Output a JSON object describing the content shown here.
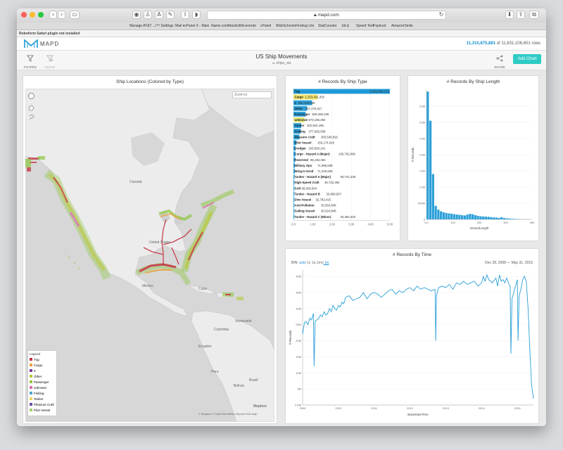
{
  "browser": {
    "url": "mapd.com",
    "bookmarks": [
      "Manage AT&T ...l™ Settings",
      "Mail ▾",
      "cPanel X - Main",
      "Name.com",
      "MarsEdit",
      "Evernote",
      "cPanel",
      "WebSchools",
      "Firebug Lite",
      "StatCounter",
      "bit.ly",
      "Speed Test",
      "Paytrust",
      "AmazonSmile"
    ],
    "plugin_notice": "Roboform Safari plugin not installed"
  },
  "app": {
    "logo_text": "MAPD",
    "rows_filtered": "11,310,875,881",
    "rows_total_text": "of 11,631,106,601 rows",
    "dashboard_title": "US Ship Movements",
    "table_name": "ships_ais",
    "filters_label": "FILTERS",
    "clear_label": "CLEAR",
    "share_label": "SHARE",
    "add_chart_label": "Add Chart",
    "accent": "#29b6f6",
    "add_chart_color": "#2ecbc4"
  },
  "map_panel": {
    "title": "Ship Locations (Colored by Type)",
    "zoom_placeholder": "Zoom to",
    "labels": [
      "Canada",
      "United States",
      "Mexico",
      "Cuba",
      "Venezuela",
      "Colombia",
      "Ecuador",
      "Peru",
      "Brazil",
      "Bolivia"
    ],
    "legend_title": "Legend",
    "legend": [
      {
        "label": "Tug",
        "color": "#c2313d"
      },
      {
        "label": "Cargo",
        "color": "#e8a23a"
      },
      {
        "label": "0",
        "color": "#7b3b9b"
      },
      {
        "label": "Other",
        "color": "#b6c93a"
      },
      {
        "label": "Passenger",
        "color": "#8dc63f"
      },
      {
        "label": "unknown",
        "color": "#d86fae"
      },
      {
        "label": "Fishing",
        "color": "#4fa3d1"
      },
      {
        "label": "Tanker",
        "color": "#e9d85a"
      },
      {
        "label": "Pleasure Craft",
        "color": "#6a50a7"
      },
      {
        "label": "Pilot Vessel",
        "color": "#a0d36e"
      }
    ],
    "attribution": "© Mapbox © OpenStreetMap Improve this map",
    "mapbox_logo": "Mapbox"
  },
  "chart_data": [
    {
      "type": "bar",
      "orientation": "horizontal",
      "title": "# Records By Ship Type",
      "categories": [
        "Tug",
        "Cargo",
        "0",
        "Other",
        "Passenger",
        "unknown",
        "Tanker",
        "Fishing",
        "Pleasure Craft",
        "Pilot Vessel",
        "Dredger",
        "Cargo - Hazard A (Major)",
        "Reserved",
        "Military Ops",
        "Wing In Grnd",
        "Tanker - Hazard A (Major)",
        "High-Speed Craft",
        "SAR",
        "Tanker - Hazard B",
        "Dive Vessel",
        "Anti-Pollution",
        "Sailing Vessel",
        "Tanker - Hazard C (Minor)"
      ],
      "value_labels": [
        "5,362,686,215",
        "1,253,441,355",
        "965,436,589",
        "707,175,317",
        "628,450,346",
        "573,186,292",
        "402,910,196",
        "377,665,508",
        "305,548,826",
        "155,174,918",
        "103,560,241",
        "100,762,096",
        "95,192,452",
        "71,895,538",
        "71,319,536",
        "50,741,239",
        "46,722,394",
        "38,928,034",
        "33,808,507",
        "32,782,415",
        "30,553,848",
        "30,024,848",
        "20,364,402"
      ],
      "values": [
        5362686215,
        1253441355,
        965436589,
        707175317,
        628450346,
        573186292,
        402910196,
        377665508,
        305548826,
        155174918,
        103560241,
        100762096,
        95192452,
        71895538,
        71319536,
        50741239,
        46722394,
        38928034,
        33808507,
        32782415,
        30553848,
        30024848,
        20364402
      ],
      "colors": [
        "#1f9ad6",
        "#f0e36a",
        "#2a9fd8",
        "#2a9fd8",
        "#2a9fd8",
        "#e8e87a",
        "#2a9fd8",
        "#2a9fd8",
        "#2a9fd8",
        "#2a9fd8",
        "#2a9fd8",
        "#2a9fd8",
        "#2a9fd8",
        "#2a9fd8",
        "#2a9fd8",
        "#2a9fd8",
        "#2a9fd8",
        "#2a9fd8",
        "#2a9fd8",
        "#2a9fd8",
        "#2a9fd8",
        "#2a9fd8",
        "#2a9fd8"
      ],
      "xlim": [
        0,
        5000000000
      ],
      "x_ticks": [
        "0.0",
        "1.00",
        "2.00",
        "3.00",
        "4.00",
        "5.00"
      ],
      "grid": true
    },
    {
      "type": "bar",
      "title": "# Records By Ship Length",
      "xlabel": "VesselLength",
      "ylabel": "# Records",
      "x": [
        5,
        15,
        25,
        35,
        45,
        55,
        65,
        75,
        85,
        95,
        105,
        115,
        125,
        135,
        145,
        155,
        165,
        175,
        185,
        195,
        205,
        215,
        225,
        235,
        245,
        255,
        265,
        275,
        285,
        295,
        305,
        315,
        325,
        335,
        345,
        355,
        365,
        375,
        385,
        395
      ],
      "values": [
        3950000000,
        3050000000,
        1400000000,
        420000000,
        300000000,
        250000000,
        220000000,
        200000000,
        185000000,
        175000000,
        160000000,
        150000000,
        140000000,
        130000000,
        120000000,
        150000000,
        170000000,
        160000000,
        130000000,
        110000000,
        95000000,
        90000000,
        85000000,
        80000000,
        70000000,
        60000000,
        55000000,
        45000000,
        70000000,
        40000000,
        30000000,
        25000000,
        18000000,
        12000000,
        8000000,
        5000000,
        3000000,
        2000000,
        1000000,
        500000
      ],
      "xlim": [
        0,
        400
      ],
      "x_ticks": [
        "0.0",
        "100",
        "200",
        "300",
        "400"
      ],
      "ylim": [
        0,
        4000000000
      ],
      "y_ticks": [
        "0",
        "500M",
        "1.0B",
        "1.5B",
        "2.0B",
        "2.5B",
        "3.0B",
        "3.5B"
      ],
      "grid": true,
      "color": "#2a9fd8"
    },
    {
      "type": "line",
      "title": "# Records By Time",
      "xlabel": "BaseDateTime",
      "ylabel": "# Records",
      "bin_label": "BIN:",
      "bin_options": [
        "auto",
        "1y",
        "1q",
        "1mo",
        "1w"
      ],
      "bin_selected": "1w",
      "date_range": "Dec 28, 2008 — May 31, 2015",
      "x_ticks": [
        "2009",
        "2010",
        "2011",
        "2012",
        "2013",
        "2014",
        "2015"
      ],
      "y_ticks": [
        "0.0M",
        "5M",
        "10M",
        "15M",
        "20M",
        "25M",
        "30M",
        "35M",
        "40M"
      ],
      "ylim": [
        0,
        42000000
      ],
      "xlim": [
        2009.0,
        2015.45
      ],
      "color": "#2a9fd8",
      "series": [
        {
          "x": [
            2009.0,
            2009.05,
            2009.1,
            2009.15,
            2009.2,
            2009.25,
            2009.3,
            2009.32,
            2009.35,
            2009.4,
            2009.45,
            2009.5,
            2009.55,
            2009.6,
            2009.65,
            2009.7,
            2009.75,
            2009.8,
            2009.85,
            2009.9,
            2009.95,
            2010.0,
            2010.05,
            2010.1,
            2010.15,
            2010.2,
            2010.3,
            2010.4,
            2010.5,
            2010.6,
            2010.7,
            2010.8,
            2010.9,
            2011.0,
            2011.1,
            2011.2,
            2011.3,
            2011.4,
            2011.5,
            2011.6,
            2011.7,
            2011.8,
            2011.9,
            2012.0,
            2012.1,
            2012.2,
            2012.3,
            2012.4,
            2012.5,
            2012.6,
            2012.7,
            2012.72,
            2012.74,
            2012.8,
            2012.9,
            2013.0,
            2013.1,
            2013.2,
            2013.3,
            2013.4,
            2013.5,
            2013.6,
            2013.7,
            2013.8,
            2013.9,
            2014.0,
            2014.05,
            2014.1,
            2014.15,
            2014.2,
            2014.3,
            2014.4,
            2014.45,
            2014.5,
            2014.55,
            2014.6,
            2014.65,
            2014.7,
            2014.75,
            2014.8,
            2014.82,
            2014.85,
            2014.9,
            2015.0,
            2015.02,
            2015.05,
            2015.1,
            2015.15,
            2015.2,
            2015.25,
            2015.3,
            2015.35,
            2015.4,
            2015.45
          ],
          "y": [
            22000000,
            25500000,
            26000000,
            25000000,
            27000000,
            26500000,
            28500000,
            12000000,
            26000000,
            26500000,
            27000000,
            28000000,
            27500000,
            29000000,
            28000000,
            28500000,
            30000000,
            29000000,
            31000000,
            30000000,
            29500000,
            31000000,
            30500000,
            32000000,
            31500000,
            33500000,
            34000000,
            32500000,
            33000000,
            33500000,
            35000000,
            33000000,
            34500000,
            35000000,
            34500000,
            33500000,
            34500000,
            35500000,
            36000000,
            34500000,
            35500000,
            35000000,
            36000000,
            36500000,
            35500000,
            37000000,
            36000000,
            36500000,
            36000000,
            35500000,
            36000000,
            20000000,
            34000000,
            36500000,
            37000000,
            36500000,
            37500000,
            36000000,
            38000000,
            37500000,
            38500000,
            37500000,
            38000000,
            38500000,
            37000000,
            38000000,
            40000000,
            38500000,
            40500000,
            39000000,
            38000000,
            39500000,
            37000000,
            40500000,
            38500000,
            39000000,
            38000000,
            39500000,
            38000000,
            37000000,
            16000000,
            33000000,
            35000000,
            39000000,
            20000000,
            34000000,
            36000000,
            39000000,
            40000000,
            38500000,
            30000000,
            17000000,
            6000000,
            2000000
          ]
        }
      ]
    }
  ]
}
